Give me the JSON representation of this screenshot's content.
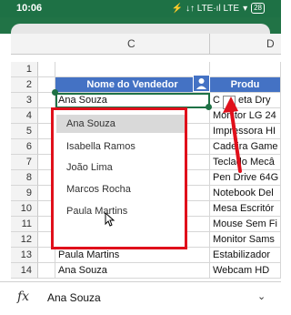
{
  "status": {
    "time": "10:06",
    "icons": "⚡ ↓↑ LTE·ıl LTE",
    "wifi": "▾",
    "battery": "28"
  },
  "columns": {
    "c_label": "C",
    "d_label": "D"
  },
  "rows": [
    {
      "num": "1",
      "c": "",
      "d": ""
    },
    {
      "num": "2",
      "c": "Nome do Vendedor",
      "d": "Produ"
    },
    {
      "num": "3",
      "c": "Ana Souza",
      "d": "C"
    },
    {
      "num": "4",
      "c": "",
      "d": "Monitor LG 24"
    },
    {
      "num": "5",
      "c": "",
      "d": "Impressora HI"
    },
    {
      "num": "6",
      "c": "",
      "d": "Cadeira Game"
    },
    {
      "num": "7",
      "c": "",
      "d": "Teclado Mecâ"
    },
    {
      "num": "8",
      "c": "",
      "d": "Pen Drive 64G"
    },
    {
      "num": "9",
      "c": "",
      "d": "Notebook Del"
    },
    {
      "num": "10",
      "c": "",
      "d": "Mesa Escritór"
    },
    {
      "num": "11",
      "c": "João Lima",
      "d": "Mouse Sem Fi"
    },
    {
      "num": "12",
      "c": "Marcos Rocha",
      "d": "Monitor Sams"
    },
    {
      "num": "13",
      "c": "Paula Martins",
      "d": "Estabilizador"
    },
    {
      "num": "14",
      "c": "Ana Souza",
      "d": "Webcam HD"
    }
  ],
  "cell_d3_tail": "eta Dry",
  "dropdown": {
    "options": [
      "Ana Souza",
      "Isabella Ramos",
      "João Lima",
      "Marcos Rocha",
      "Paula Martins"
    ],
    "selected": "Ana Souza"
  },
  "formula_bar": {
    "fx": "fx",
    "value": "Ana Souza",
    "chevron": "⌄"
  },
  "colors": {
    "header_fill": "#4472c4",
    "highlight": "#e0101b",
    "excel_green": "#217346"
  }
}
